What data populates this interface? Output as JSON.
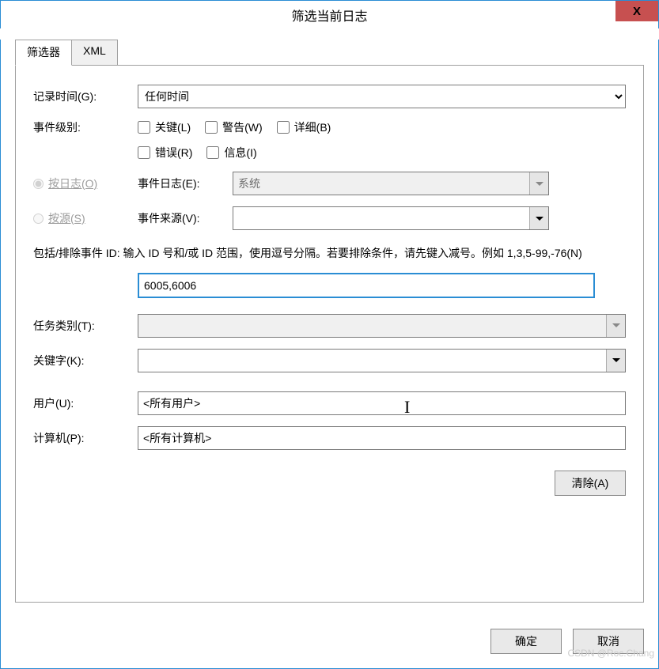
{
  "title": "筛选当前日志",
  "close_label": "X",
  "tabs": {
    "filter": "筛选器",
    "xml": "XML"
  },
  "labels": {
    "logged": "记录时间(G):",
    "event_level": "事件级别:",
    "by_log": "按日志(O)",
    "by_source": "按源(S)",
    "event_logs": "事件日志(E):",
    "event_sources": "事件来源(V):",
    "task_category": "任务类别(T):",
    "keywords": "关键字(K):",
    "user": "用户(U):",
    "computer": "计算机(P):"
  },
  "logged_value": "任何时间",
  "level_checks": {
    "critical": "关键(L)",
    "warning": "警告(W)",
    "verbose": "详细(B)",
    "error": "错误(R)",
    "information": "信息(I)"
  },
  "event_logs_value": "系统",
  "event_sources_value": "",
  "help_text": "包括/排除事件 ID: 输入 ID 号和/或 ID 范围，使用逗号分隔。若要排除条件，请先键入减号。例如 1,3,5-99,-76(N)",
  "event_id_value": "6005,6006",
  "task_category_value": "",
  "keywords_value": "",
  "user_value": "<所有用户>",
  "computer_value": "<所有计算机>",
  "buttons": {
    "clear": "清除(A)",
    "ok": "确定",
    "cancel": "取消"
  },
  "watermark": "CSDN @Roc.Chang"
}
